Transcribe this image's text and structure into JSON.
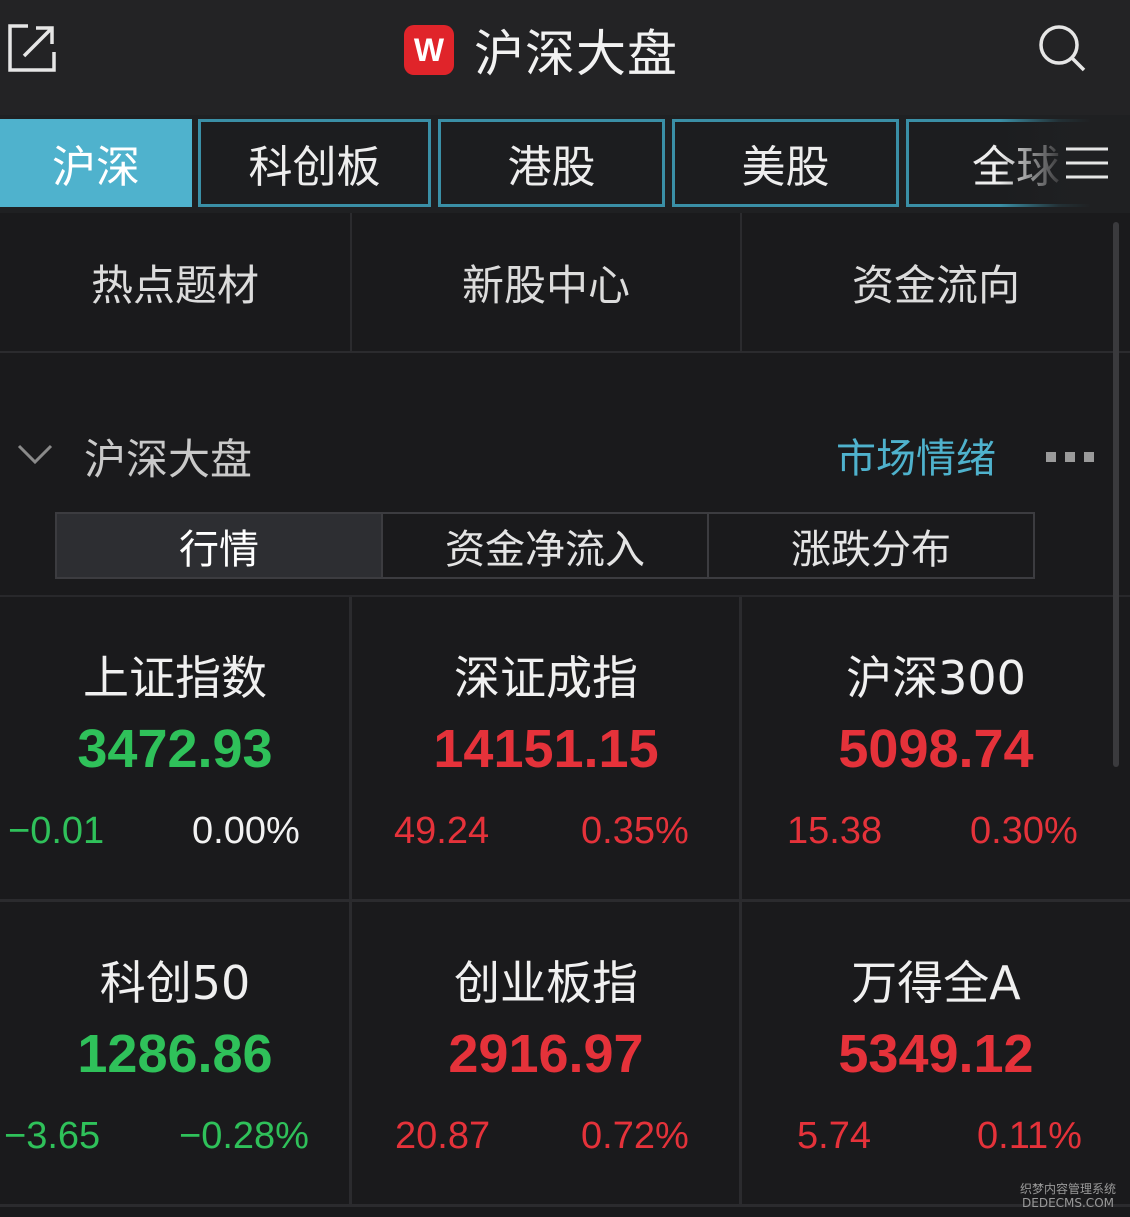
{
  "header": {
    "title": "沪深大盘",
    "logo_text": "W",
    "icons": {
      "left": "share-external-icon",
      "right": "search-icon"
    }
  },
  "market_tabs": [
    {
      "label": "沪深",
      "active": true
    },
    {
      "label": "科创板",
      "active": false
    },
    {
      "label": "港股",
      "active": false
    },
    {
      "label": "美股",
      "active": false
    },
    {
      "label": "全球",
      "active": false
    }
  ],
  "shortcuts": [
    "热点题材",
    "新股中心",
    "资金流向"
  ],
  "section": {
    "title": "沪深大盘",
    "link": "市场情绪"
  },
  "segments": [
    {
      "label": "行情",
      "active": true
    },
    {
      "label": "资金净流入",
      "active": false
    },
    {
      "label": "涨跌分布",
      "active": false
    }
  ],
  "indices": [
    {
      "name": "上证指数",
      "price": "3472.93",
      "change": "−0.01",
      "percent": "0.00%",
      "trend": "down"
    },
    {
      "name": "深证成指",
      "price": "14151.15",
      "change": "49.24",
      "percent": "0.35%",
      "trend": "up"
    },
    {
      "name": "沪深300",
      "price": "5098.74",
      "change": "15.38",
      "percent": "0.30%",
      "trend": "up"
    },
    {
      "name": "科创50",
      "price": "1286.86",
      "change": "−3.65",
      "percent": "−0.28%",
      "trend": "down"
    },
    {
      "name": "创业板指",
      "price": "2916.97",
      "change": "20.87",
      "percent": "0.72%",
      "trend": "up"
    },
    {
      "name": "万得全A",
      "price": "5349.12",
      "change": "5.74",
      "percent": "0.11%",
      "trend": "up"
    }
  ],
  "watermark": {
    "line1": "织梦内容管理系统",
    "line2": "DEDECMS.COM"
  },
  "colors": {
    "up": "#e5323a",
    "down": "#2fc15a",
    "accent": "#4fb2cd",
    "logo": "#e0242a"
  }
}
